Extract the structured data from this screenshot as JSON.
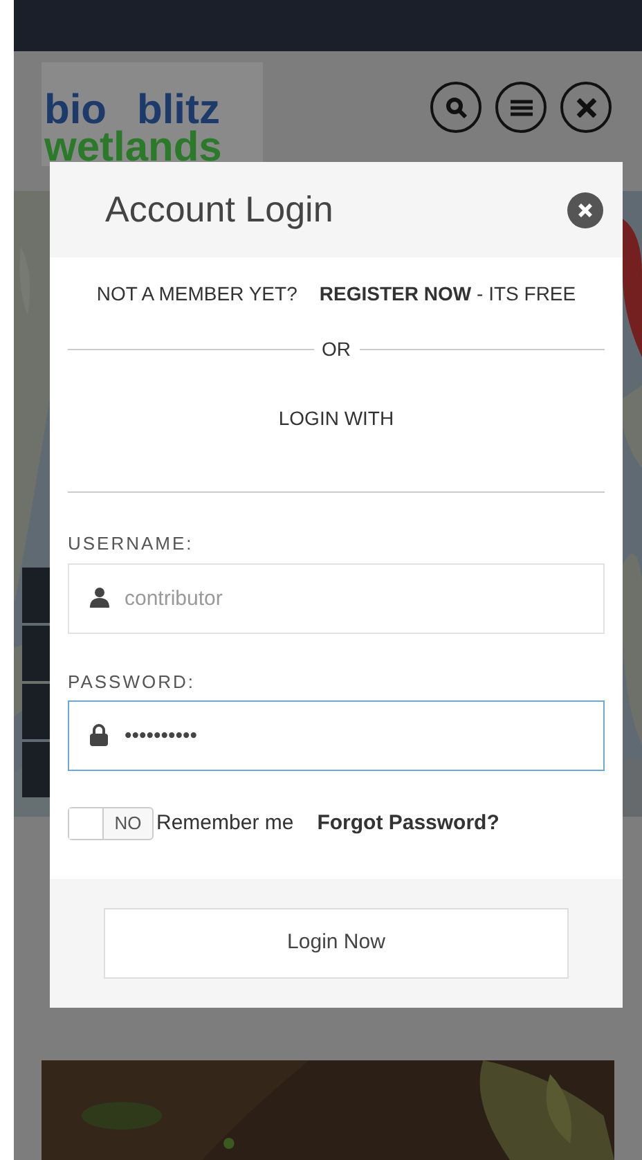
{
  "header": {
    "logo": [
      "bio",
      "blitz",
      "wetlands"
    ]
  },
  "modal": {
    "title": "Account Login",
    "register": {
      "prompt": "NOT A MEMBER YET?",
      "link": "REGISTER NOW",
      "suffix": "- ITS FREE"
    },
    "divider": "OR",
    "login_with": "LOGIN WITH",
    "fields": [
      {
        "label": "USERNAME:",
        "placeholder": "contributor",
        "kind": "user",
        "focused": false
      },
      {
        "label": "PASSWORD:",
        "value": "••••••••••",
        "kind": "password",
        "focused": true
      }
    ],
    "remember": {
      "toggle": "NO",
      "on": false,
      "label": "Remember me"
    },
    "forgot": "Forgot Password?",
    "submit": "Login Now"
  }
}
